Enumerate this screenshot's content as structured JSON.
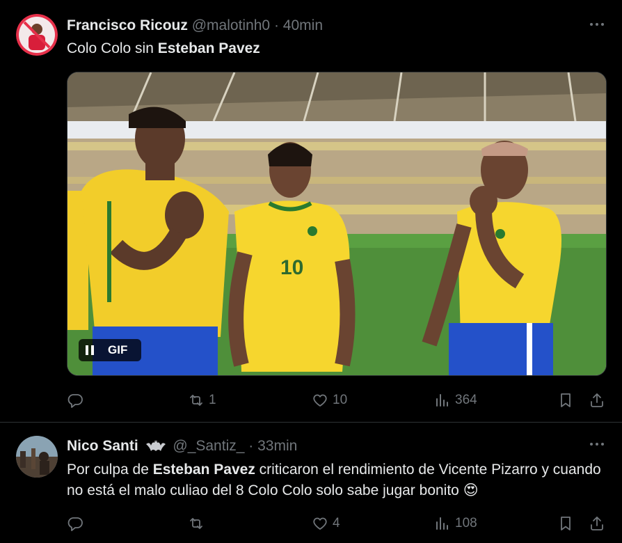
{
  "tweets": [
    {
      "name": "Francisco Ricouz",
      "handle": "@malotinh0",
      "sep": "·",
      "time": "40min",
      "text_parts": [
        "Colo Colo sin ",
        "Esteban Pavez"
      ],
      "media": {
        "label": "GIF",
        "jersey_number": "10"
      },
      "stats": {
        "replies": "",
        "reposts": "1",
        "likes": "10",
        "views": "364"
      }
    },
    {
      "name": "Nico Santi",
      "handle": "@_Santiz_",
      "sep": "·",
      "time": "33min",
      "text_parts": [
        "Por culpa de ",
        "Esteban Pavez",
        " criticaron el rendimiento de Vicente Pizarro y cuando no está el malo culiao del 8 Colo Colo solo sabe jugar bonito ",
        "😍"
      ],
      "stats": {
        "replies": "",
        "reposts": "",
        "likes": "4",
        "views": "108"
      }
    }
  ],
  "icons": {
    "more": "more-icon",
    "reply": "reply-icon",
    "repost": "repost-icon",
    "like": "like-icon",
    "views": "views-icon",
    "bookmark": "bookmark-icon",
    "share": "share-icon",
    "pause": "pause-icon",
    "bat": "bat-icon"
  },
  "colors": {
    "background": "#000000",
    "text": "#e7e9ea",
    "muted": "#71767b",
    "border": "#2f3336"
  }
}
